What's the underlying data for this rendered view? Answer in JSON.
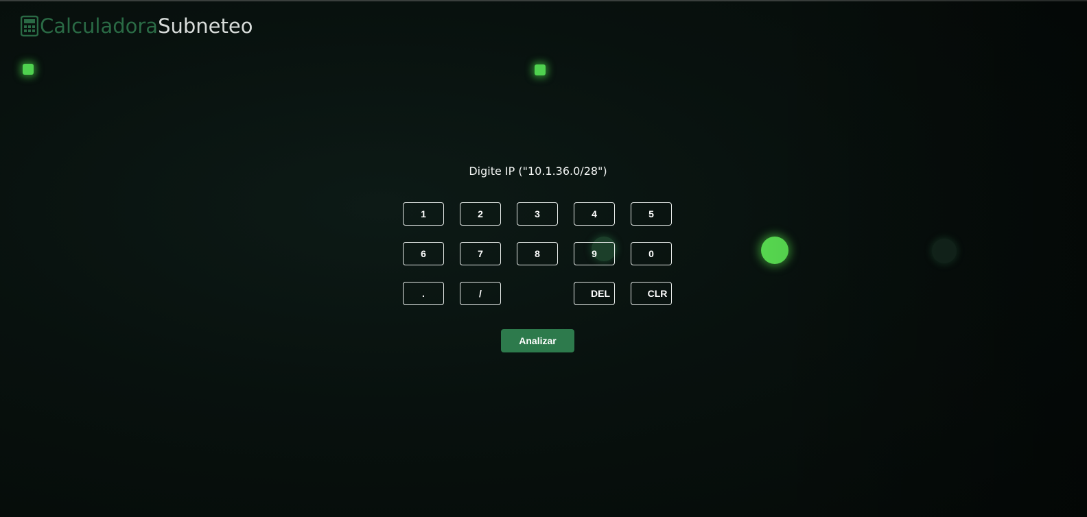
{
  "app": {
    "title_part1": "Calculadora",
    "title_part2": "Subneteo",
    "logo_icon": "calculator-icon"
  },
  "prompt": {
    "text": "Digite IP (\"10.1.36.0/28\")"
  },
  "keypad": {
    "row1": [
      "1",
      "2",
      "3",
      "4",
      "5"
    ],
    "row2": [
      "6",
      "7",
      "8",
      "9",
      "0"
    ],
    "row3": [
      ".",
      "/",
      "DEL",
      "CLR"
    ]
  },
  "actions": {
    "analyze_label": "Analizar"
  },
  "colors": {
    "accent": "#2d7a4c",
    "logo_green": "#2a6a45",
    "glow_green": "#4fd14f",
    "background": "#08110e"
  }
}
